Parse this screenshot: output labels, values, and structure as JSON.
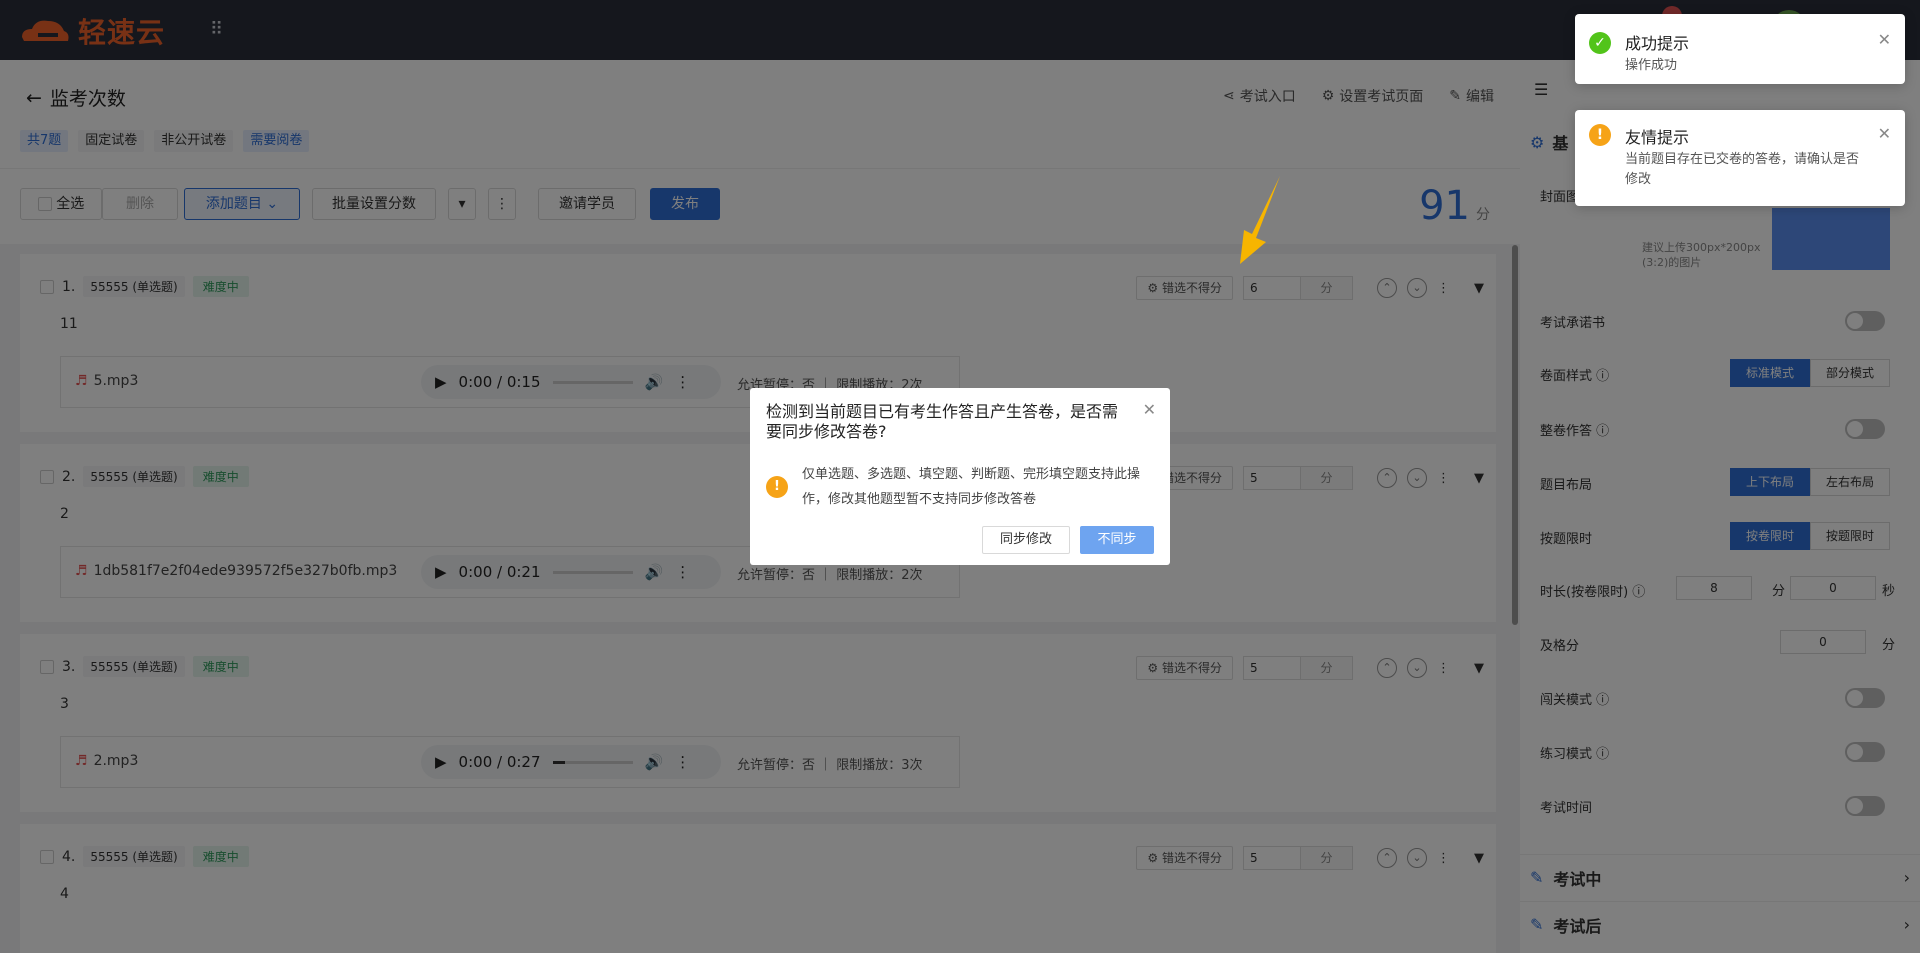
{
  "app": {
    "logo_text": "轻速云"
  },
  "page": {
    "back_title": "监考次数",
    "tags": [
      "共7题",
      "固定试卷",
      "非公开试卷",
      "需要阅卷"
    ],
    "header_actions": [
      "考试入口",
      "设置考试页面",
      "编辑"
    ]
  },
  "toolbar": {
    "select_all": "全选",
    "delete": "删除",
    "add_question": "添加题目",
    "batch_score": "批量设置分数",
    "invite": "邀请学员",
    "publish": "发布",
    "total_score": "91",
    "score_unit": "分"
  },
  "questions": [
    {
      "num": "1.",
      "type": "55555 (单选题)",
      "difficulty": "难度中",
      "text": "11",
      "wrong_label": "错选不得分",
      "score": "6",
      "unit": "分",
      "file": "5.mp3",
      "time": "0:00 / 0:15",
      "progress": 0,
      "meta": "允许暂停：否 ｜ 限制播放：2次"
    },
    {
      "num": "2.",
      "type": "55555 (单选题)",
      "difficulty": "难度中",
      "text": "2",
      "wrong_label": "错选不得分",
      "score": "5",
      "unit": "分",
      "file": "1db581f7e2f04ede939572f5e327b0fb.mp3",
      "time": "0:00 / 0:21",
      "progress": 0,
      "meta": "允许暂停：否 ｜ 限制播放：2次"
    },
    {
      "num": "3.",
      "type": "55555 (单选题)",
      "difficulty": "难度中",
      "text": "3",
      "wrong_label": "错选不得分",
      "score": "5",
      "unit": "分",
      "file": "2.mp3",
      "time": "0:00 / 0:27",
      "progress": 0.15,
      "meta": "允许暂停：否 ｜ 限制播放：3次"
    },
    {
      "num": "4.",
      "type": "55555 (单选题)",
      "difficulty": "难度中",
      "text": "4",
      "wrong_label": "错选不得分",
      "score": "5",
      "unit": "分"
    }
  ],
  "right_panel": {
    "cover_label": "封面图",
    "cover_hint": "建议上传300px*200px (3:2)的图片",
    "rows": {
      "promise": "考试承诺书",
      "paper_style": "卷面样式",
      "whole_answer": "整卷作答",
      "layout": "题目布局",
      "limit": "按题限时",
      "duration": "时长(按卷限时)",
      "pass_score": "及格分",
      "checkpoint": "闯关模式",
      "practice": "练习模式",
      "exam_time": "考试时间"
    },
    "paper_style_opts": [
      "标准模式",
      "部分模式"
    ],
    "layout_opts": [
      "上下布局",
      "左右布局"
    ],
    "limit_opts": [
      "按卷限时",
      "按题限时"
    ],
    "duration_min": "8",
    "duration_sec": "0",
    "minute_unit": "分",
    "second_unit": "秒",
    "pass_value": "0",
    "section_during": "考试中",
    "section_after": "考试后",
    "section_basic": "基"
  },
  "notices": [
    {
      "title": "成功提示",
      "content": "操作成功",
      "color": "#52c41a"
    },
    {
      "title": "友情提示",
      "content": "当前题目存在已交卷的答卷，请确认是否修改",
      "color": "#f6a317"
    }
  ],
  "modal": {
    "title": "检测到当前题目已有考生作答且产生答卷，是否需要同步修改答卷?",
    "message": "仅单选题、多选题、填空题、判断题、完形填空题支持此操作，修改其他题型暂不支持同步修改答卷",
    "sync_button": "同步修改",
    "nosync_button": "不同步"
  }
}
